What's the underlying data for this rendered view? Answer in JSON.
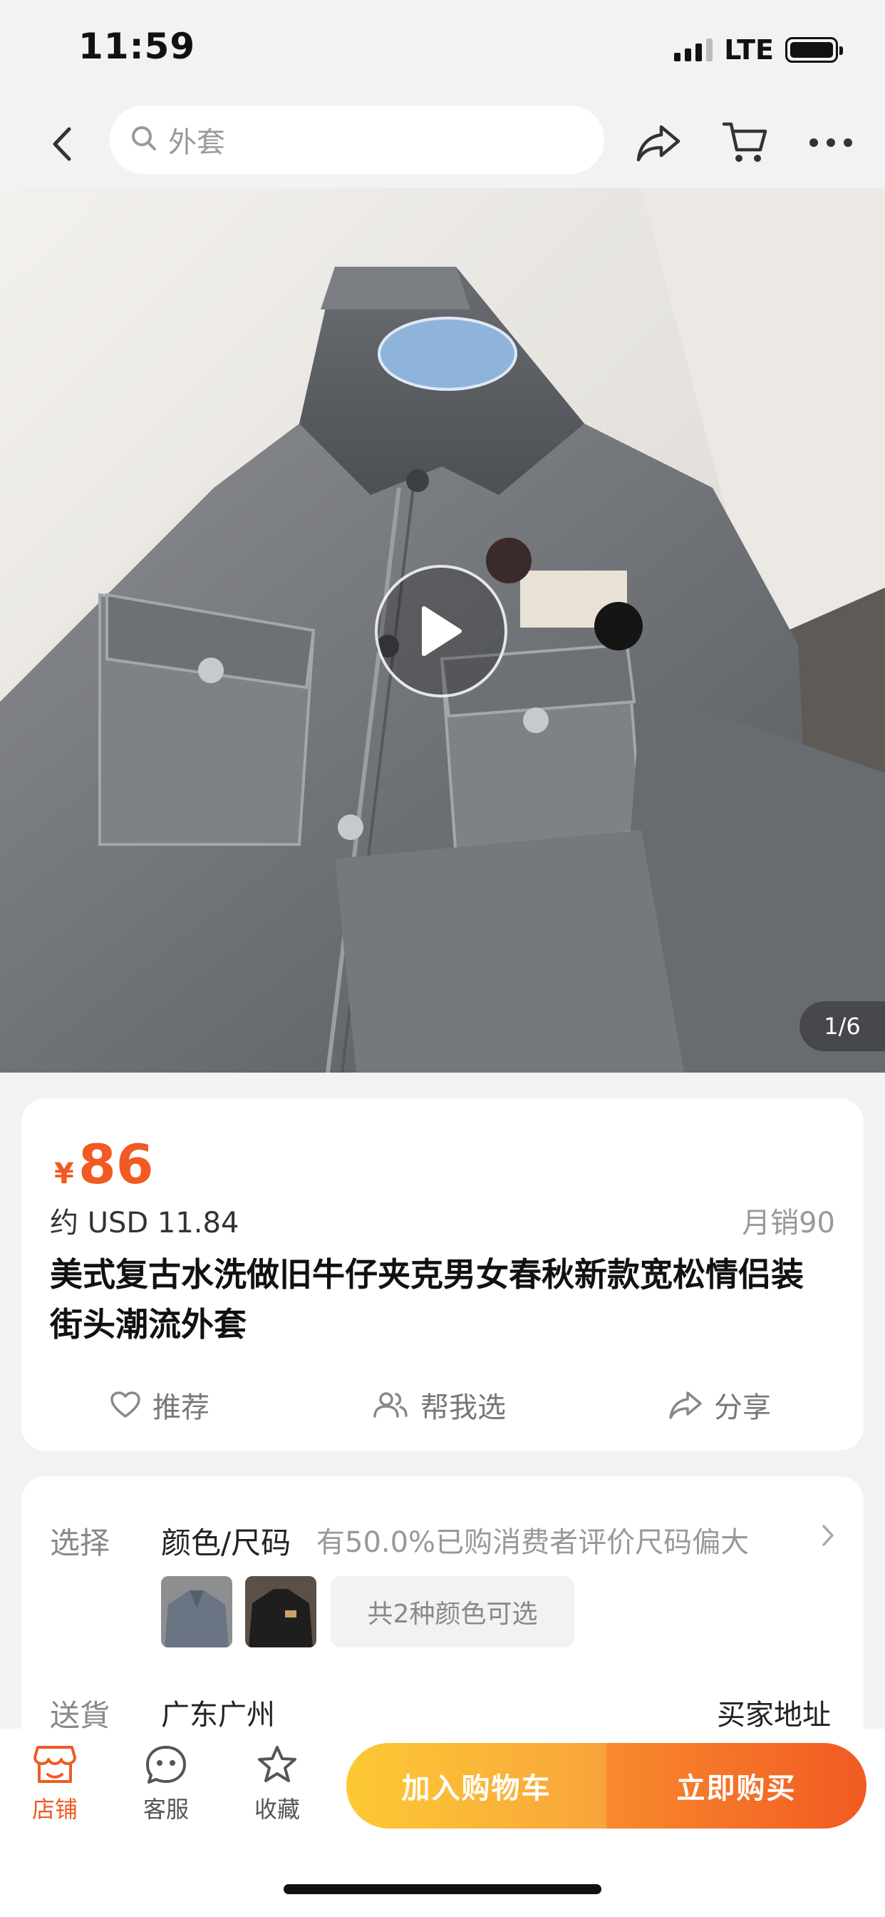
{
  "status_bar": {
    "time": "11:59",
    "network": "LTE",
    "battery_level": 1.0
  },
  "nav": {
    "search_placeholder": "外套",
    "icons": [
      "back-arrow-icon",
      "search-icon",
      "share-icon",
      "cart-icon",
      "more-icon"
    ]
  },
  "media": {
    "counter": "1/6",
    "has_video": true
  },
  "product": {
    "currency_symbol": "¥",
    "price": "86",
    "usd_price": "约 USD 11.84",
    "monthly_sales": "月销90",
    "title": "美式复古水洗做旧牛仔夹克男女春秋新款宽松情侣装街头潮流外套",
    "actions": {
      "recommend": "推荐",
      "help_choose": "帮我选",
      "share": "分享"
    }
  },
  "selection": {
    "label": "选择",
    "title": "颜色/尺码",
    "note": "有50.0%已购消费者评价尺码偏大",
    "colors_available": "共2种颜色可选",
    "swatch_count": 2
  },
  "shipping": {
    "label": "送貨",
    "from": "广东广州",
    "to": "买家地址"
  },
  "bottom_bar": {
    "store": "店铺",
    "service": "客服",
    "favorite": "收藏",
    "add_to_cart": "加入购物车",
    "buy_now": "立即购买"
  },
  "colors": {
    "accent": "#f15a22",
    "cart_gradient_start": "#fdc934",
    "buy_gradient_end": "#f15a22"
  }
}
